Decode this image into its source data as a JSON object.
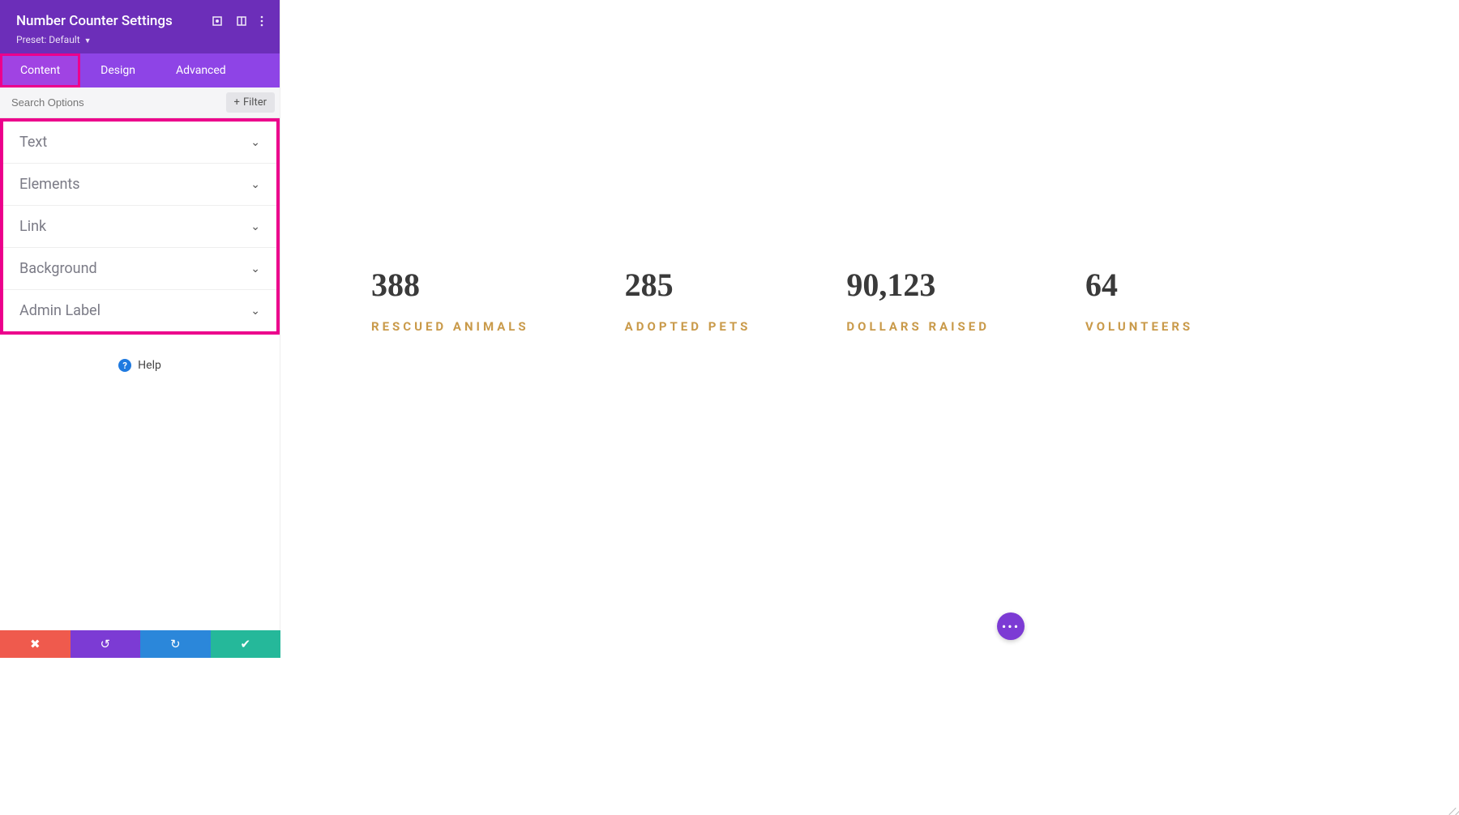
{
  "sidebar": {
    "title": "Number Counter Settings",
    "preset_label": "Preset: Default",
    "tabs": [
      "Content",
      "Design",
      "Advanced"
    ],
    "active_tab": 0,
    "search_placeholder": "Search Options",
    "filter_label": "Filter",
    "accordion": [
      "Text",
      "Elements",
      "Link",
      "Background",
      "Admin Label"
    ],
    "help_label": "Help"
  },
  "footer": {
    "cancel": "✖",
    "undo": "↺",
    "redo": "↻",
    "save": "✔"
  },
  "counters": [
    {
      "value": "388",
      "label": "RESCUED ANIMALS"
    },
    {
      "value": "285",
      "label": "ADOPTED PETS"
    },
    {
      "value": "90,123",
      "label": "DOLLARS RAISED"
    },
    {
      "value": "64",
      "label": "VOLUNTEERS"
    }
  ],
  "fab": "•••",
  "colors": {
    "purple_dark": "#6c2eb9",
    "purple_tab": "#8e44e6",
    "purple_active": "#a043e3",
    "highlight": "#ec008c",
    "counter_label": "#c99a4a"
  }
}
